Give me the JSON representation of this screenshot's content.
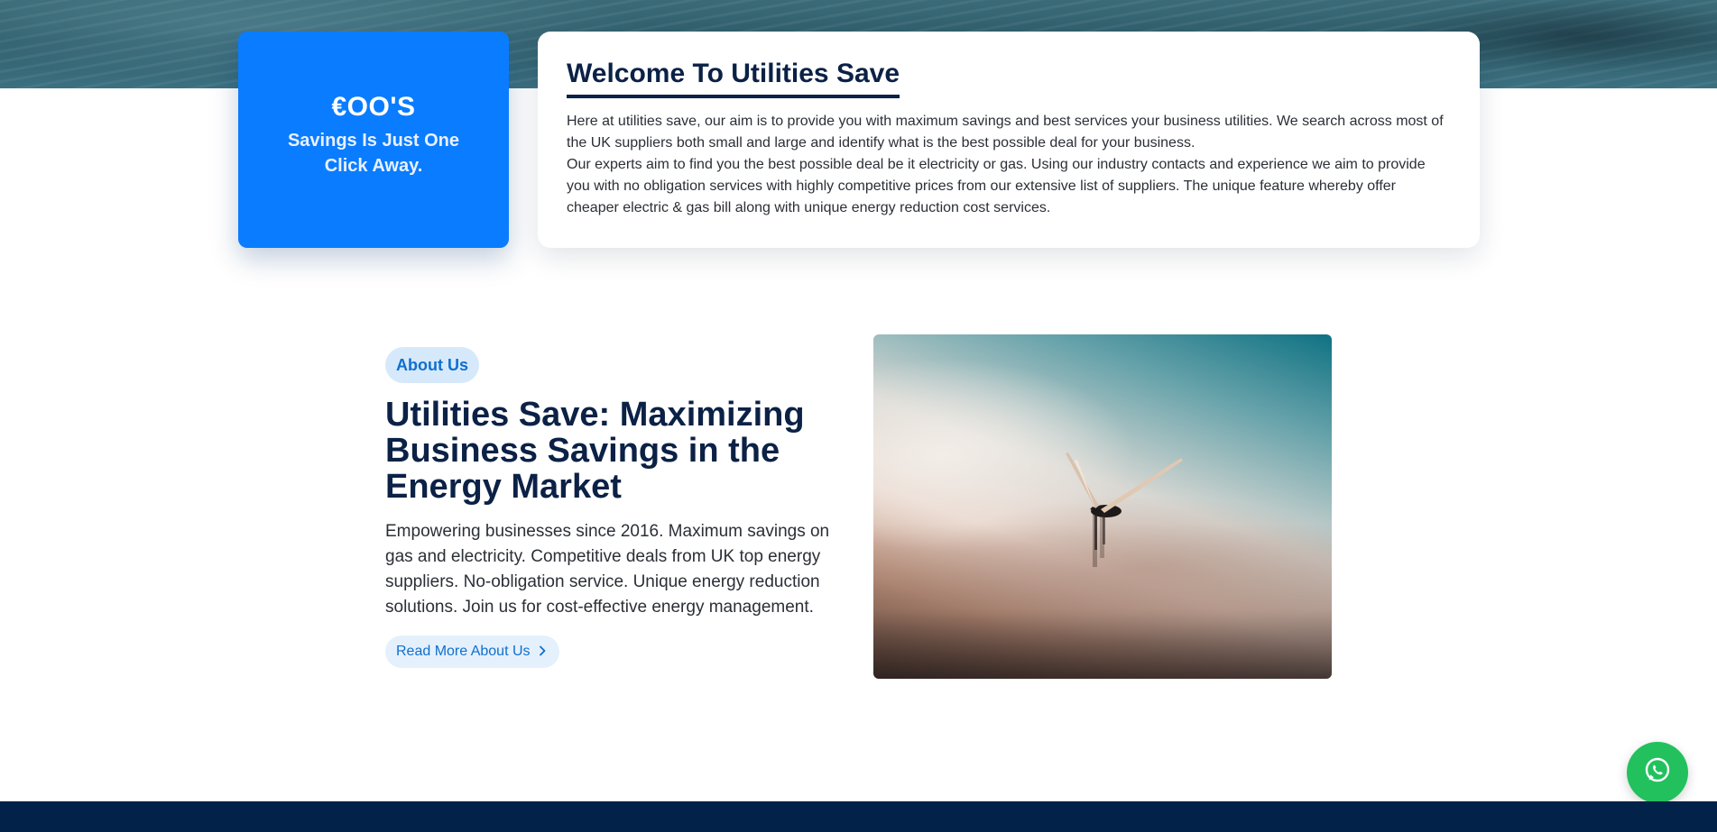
{
  "savings_card": {
    "amount": "€OO'S",
    "subtitle": "Savings Is Just One Click Away."
  },
  "welcome": {
    "title": "Welcome To Utilities Save",
    "paragraph_1": "Here at utilities save, our aim is to provide you with maximum savings and best services your business utilities. We search across most of the UK suppliers both small and large and identify what is the best possible deal for your business.",
    "paragraph_2": "Our experts aim to find you the best possible deal be it electricity or gas. Using our industry contacts and experience we aim to provide you with no obligation services with highly competitive prices from our extensive list of suppliers. The unique feature whereby offer cheaper electric & gas bill along with unique energy reduction cost services."
  },
  "about": {
    "badge": "About Us",
    "title": "Utilities Save: Maximizing Business Savings in the Energy Market",
    "description": "Empowering businesses since 2016. Maximum savings on gas and electricity. Competitive deals from UK top energy suppliers. No-obligation service. Unique energy reduction solutions. Join us for cost-effective energy management.",
    "read_more_label": "Read More About Us",
    "read_more_icon": "chevron-right-icon",
    "image_subject": "wind-turbine-above-fog"
  },
  "floating": {
    "whatsapp_icon": "whatsapp-icon"
  },
  "colors": {
    "brand_blue": "#0a7cff",
    "navy": "#0b2146",
    "footer_navy": "#03224a",
    "whatsapp_green": "#22c15e",
    "badge_bg": "#d6e9fb"
  }
}
